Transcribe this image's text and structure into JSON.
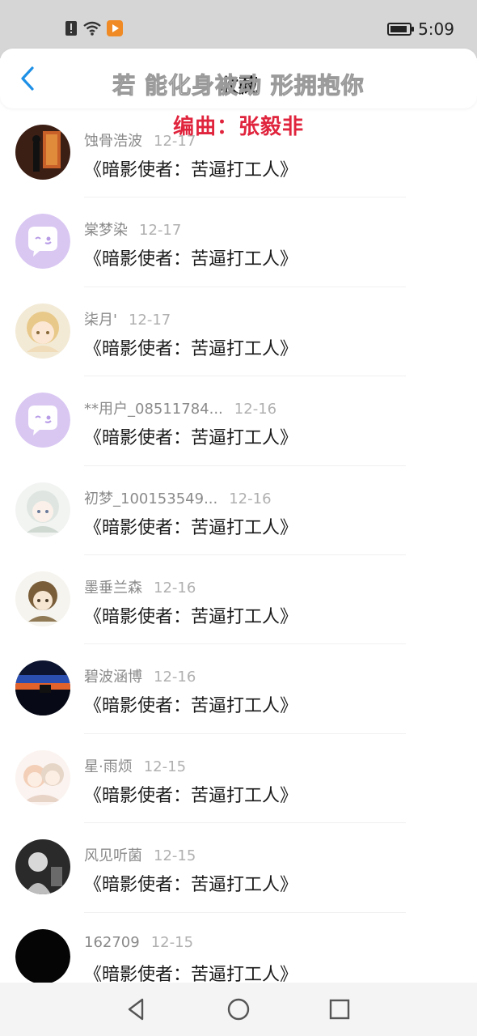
{
  "status_bar": {
    "time": "5:09",
    "icons": [
      "alert-icon",
      "wifi-icon",
      "media-play-icon"
    ]
  },
  "header": {
    "overlay_text": "若 能化身被动 形拥抱你",
    "title": "收藏",
    "subtitle": "编曲：张毅非"
  },
  "colors": {
    "accent": "#1e90e6",
    "subtitle_red": "#e0243d"
  },
  "list": [
    {
      "user": "蚀骨浩波",
      "date": "12-17",
      "text": "《暗影使者：苦逼打工人》",
      "avatar": "dark-figure"
    },
    {
      "user": "棠梦染",
      "date": "12-17",
      "text": "《暗影使者：苦逼打工人》",
      "avatar": "default-chat-icon"
    },
    {
      "user": "柒月'",
      "date": "12-17",
      "text": "《暗影使者：苦逼打工人》",
      "avatar": "anime-girl-blonde"
    },
    {
      "user": "**用户_08511784...",
      "date": "12-16",
      "text": "《暗影使者：苦逼打工人》",
      "avatar": "default-chat-icon"
    },
    {
      "user": "初梦_100153549...",
      "date": "12-16",
      "text": "《暗影使者：苦逼打工人》",
      "avatar": "anime-girl-white"
    },
    {
      "user": "墨垂兰森",
      "date": "12-16",
      "text": "《暗影使者：苦逼打工人》",
      "avatar": "anime-girl-brown"
    },
    {
      "user": "碧波涵博",
      "date": "12-16",
      "text": "《暗影使者：苦逼打工人》",
      "avatar": "sunset-photo"
    },
    {
      "user": "星·雨烦",
      "date": "12-15",
      "text": "《暗影使者：苦逼打工人》",
      "avatar": "anime-couple-pastel"
    },
    {
      "user": "风见听菌",
      "date": "12-15",
      "text": "《暗影使者：苦逼打工人》",
      "avatar": "bw-singer-photo"
    },
    {
      "user": "162709",
      "date": "12-15",
      "text": "《暗影使者：苦逼打工人》",
      "avatar": "black-avatar"
    }
  ],
  "nav": {
    "buttons": [
      "back-triangle-icon",
      "home-circle-icon",
      "recents-square-icon"
    ]
  }
}
